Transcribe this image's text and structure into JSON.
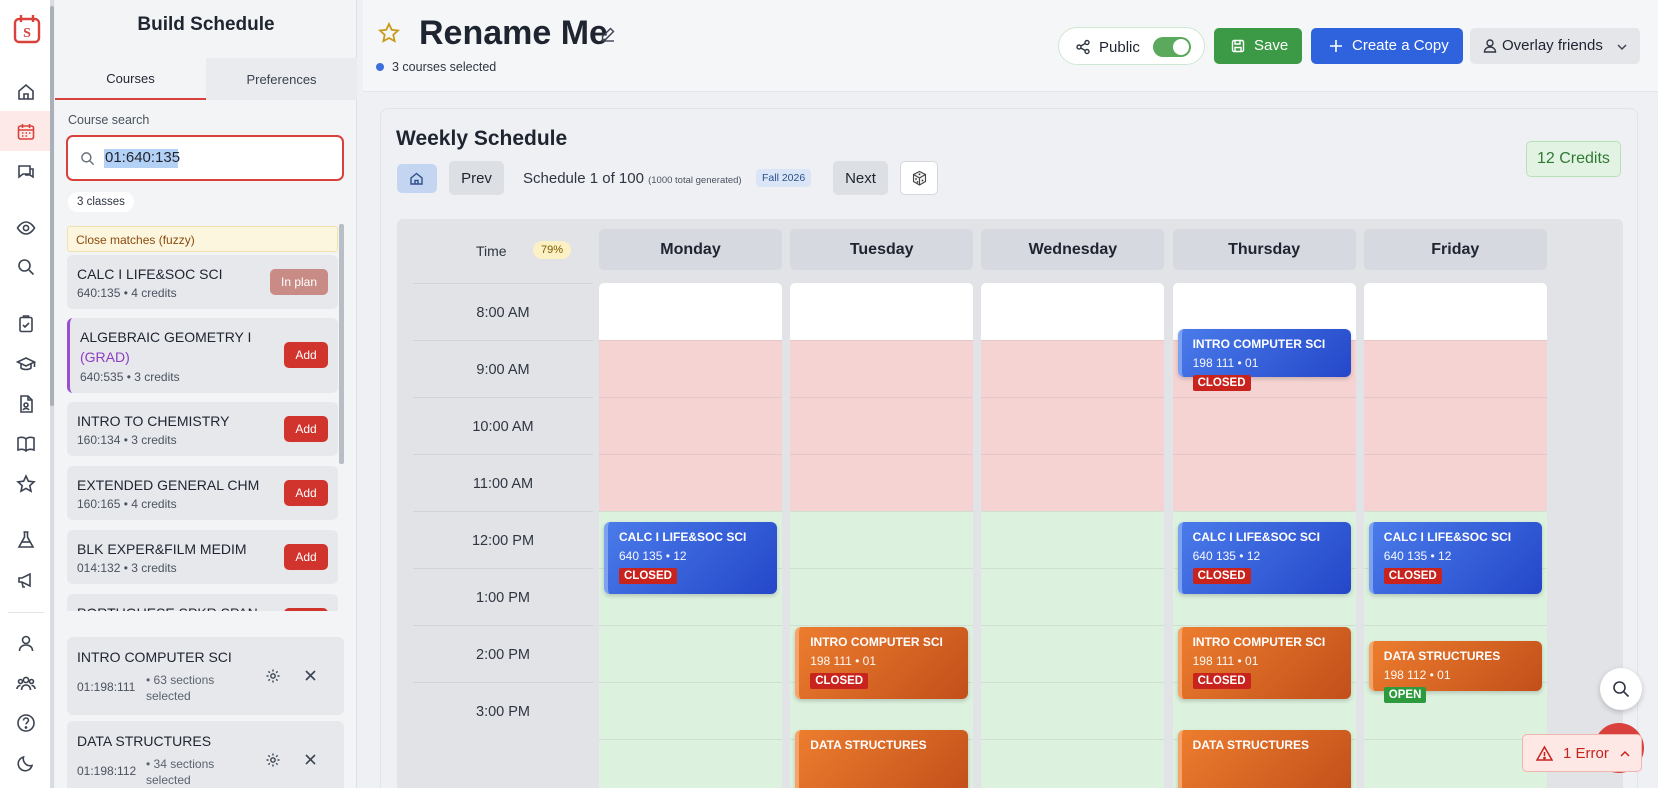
{
  "colors": {
    "accent": "#d9413c",
    "primary": "#2f62dd",
    "success": "#3c9a46",
    "closed": "#c9231d",
    "open": "#2e9a3e"
  },
  "rail": {
    "logo_letter": "S",
    "icons": [
      "home-icon",
      "calendar-icon",
      "chat-icon",
      "eye-icon",
      "search-icon",
      "clipboard-check-icon",
      "graduation-cap-icon",
      "document-icon",
      "book-icon",
      "star-icon",
      "flask-icon",
      "megaphone-icon",
      "user-icon",
      "group-icon",
      "help-icon",
      "moon-icon"
    ]
  },
  "sidebar": {
    "title": "Build Schedule",
    "tabs": [
      {
        "label": "Courses"
      },
      {
        "label": "Preferences"
      }
    ],
    "search_label": "Course search",
    "search_value": "01:640:135",
    "results_count": "3 classes",
    "fuzzy_notice": "Close matches (fuzzy)",
    "results": [
      {
        "name": "CALC I LIFE&SOC SCI",
        "grad": "",
        "meta": "640:135 • 4 credits",
        "action": "In plan"
      },
      {
        "name": "ALGEBRAIC GEOMETRY I",
        "grad": "(GRAD)",
        "meta": "640:535 • 3 credits",
        "action": "Add"
      },
      {
        "name": "INTRO TO CHEMISTRY",
        "grad": "",
        "meta": "160:134 • 3 credits",
        "action": "Add"
      },
      {
        "name": "EXTENDED GENERAL CHM",
        "grad": "",
        "meta": "160:165 • 4 credits",
        "action": "Add"
      },
      {
        "name": "BLK EXPER&FILM MEDIM",
        "grad": "",
        "meta": "014:132 • 3 credits",
        "action": "Add"
      },
      {
        "name": "PORTUGUESE SPKR SPAN",
        "grad": "",
        "meta": "",
        "action": "Add"
      }
    ],
    "selected": [
      {
        "name": "INTRO COMPUTER SCI",
        "code": "01:198:111",
        "sections": "• 63 sections selected"
      },
      {
        "name": "DATA STRUCTURES",
        "code": "01:198:112",
        "sections": "• 34 sections selected"
      }
    ]
  },
  "header": {
    "title": "Rename Me",
    "subtitle": "3 courses selected",
    "public_label": "Public",
    "public_on": true,
    "save_label": "Save",
    "copy_label": "Create a Copy",
    "overlay_label": "Overlay friends"
  },
  "schedule": {
    "title": "Weekly Schedule",
    "credits": "12 Credits",
    "prev_label": "Prev",
    "next_label": "Next",
    "position_text": "Schedule 1 of 100",
    "generated_text": "(1000 total generated)",
    "term": "Fall 2026",
    "time_header": "Time",
    "time_percent": "79%",
    "times": [
      "8:00 AM",
      "9:00 AM",
      "10:00 AM",
      "11:00 AM",
      "12:00 PM",
      "1:00 PM",
      "2:00 PM",
      "3:00 PM"
    ],
    "days": [
      "Monday",
      "Tuesday",
      "Wednesday",
      "Thursday",
      "Friday"
    ],
    "events": [
      {
        "day": "Monday",
        "name": "CALC I LIFE&SOC SCI",
        "meta": "640 135 • 12",
        "status": "CLOSED",
        "color": "blue",
        "start": 12.2,
        "end": 13.45
      },
      {
        "day": "Tuesday",
        "name": "INTRO COMPUTER SCI",
        "meta": "198 111 • 01",
        "status": "CLOSED",
        "color": "orange",
        "start": 14.03,
        "end": 15.3
      },
      {
        "day": "Tuesday",
        "name": "DATA STRUCTURES",
        "meta": "",
        "status": "",
        "color": "orange",
        "start": 15.85,
        "end": 17.0
      },
      {
        "day": "Thursday",
        "name": "INTRO COMPUTER SCI",
        "meta": "198 111 • 01",
        "status": "CLOSED",
        "color": "blue",
        "start": 8.8,
        "end": 9.65
      },
      {
        "day": "Thursday",
        "name": "CALC I LIFE&SOC SCI",
        "meta": "640 135 • 12",
        "status": "CLOSED",
        "color": "blue",
        "start": 12.2,
        "end": 13.45
      },
      {
        "day": "Thursday",
        "name": "INTRO COMPUTER SCI",
        "meta": "198 111 • 01",
        "status": "CLOSED",
        "color": "orange",
        "start": 14.03,
        "end": 15.3
      },
      {
        "day": "Thursday",
        "name": "DATA STRUCTURES",
        "meta": "",
        "status": "",
        "color": "orange",
        "start": 15.85,
        "end": 17.0
      },
      {
        "day": "Friday",
        "name": "CALC I LIFE&SOC SCI",
        "meta": "640 135 • 12",
        "status": "CLOSED",
        "color": "blue",
        "start": 12.2,
        "end": 13.45
      },
      {
        "day": "Friday",
        "name": "DATA STRUCTURES",
        "meta": "198 112 • 01",
        "status": "OPEN",
        "color": "orange",
        "start": 14.28,
        "end": 15.15
      }
    ]
  },
  "error": {
    "label": "1 Error"
  }
}
